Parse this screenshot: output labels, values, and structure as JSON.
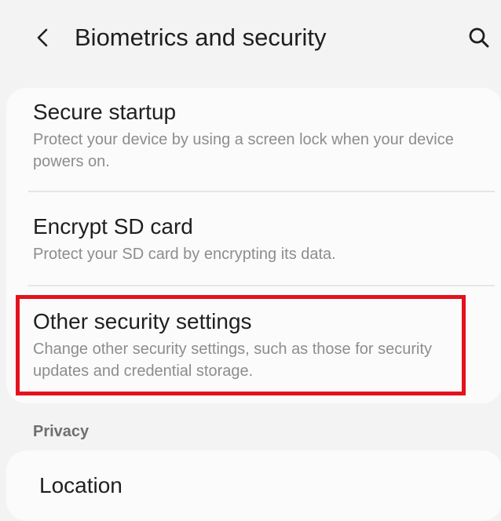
{
  "header": {
    "title": "Biometrics and security",
    "back_icon": "chevron-left-icon",
    "search_icon": "search-icon"
  },
  "items": [
    {
      "title": "Secure startup",
      "subtitle": "Protect your device by using a screen lock when your device powers on."
    },
    {
      "title": "Encrypt SD card",
      "subtitle": "Protect your SD card by encrypting its data."
    },
    {
      "title": "Other security settings",
      "subtitle": "Change other security settings, such as those for security updates and credential storage."
    }
  ],
  "privacy_section": {
    "header": "Privacy",
    "items": [
      {
        "title": "Location"
      }
    ]
  },
  "colors": {
    "background": "#f3f3f3",
    "card": "#fbfbfb",
    "highlight": "#e3121d",
    "subtitle": "#8d8d8d"
  }
}
